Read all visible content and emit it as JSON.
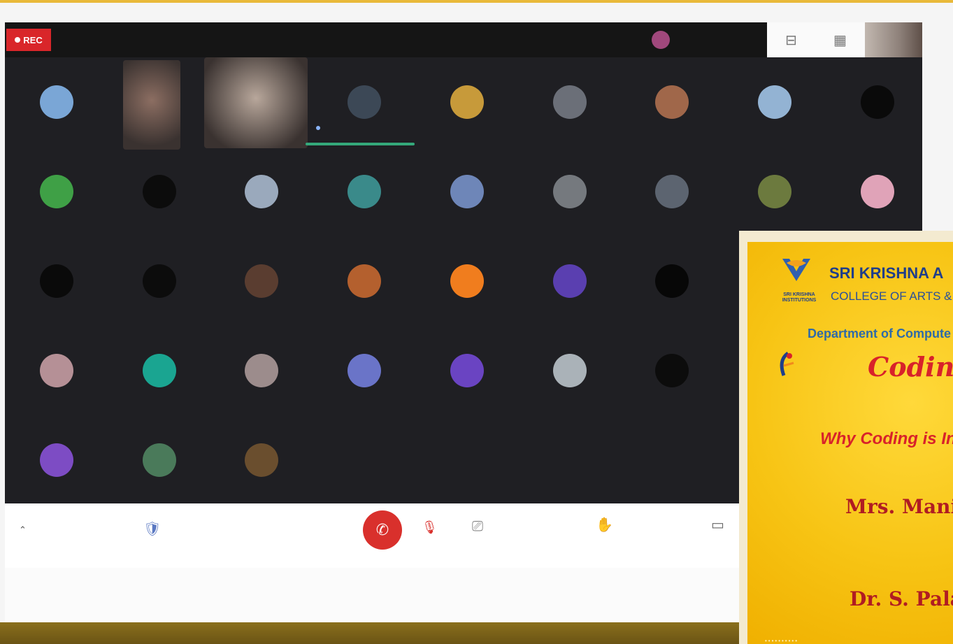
{
  "meeting": {
    "rec_label": "REC",
    "speaking_name": "",
    "speaking_sub": "",
    "speaker_name": "",
    "details_label": "",
    "url": ""
  },
  "participants": [
    {
      "type": "avatar",
      "color": "#7aa6d6",
      "initial": ""
    },
    {
      "type": "video",
      "color": "#8c6e62"
    },
    {
      "type": "video",
      "color": "#b8a79b"
    },
    {
      "type": "avatar",
      "color": "#3c4856",
      "initial": ""
    },
    {
      "type": "avatar",
      "color": "#c79a3a",
      "initial": ""
    },
    {
      "type": "avatar",
      "color": "#6b6f78",
      "initial": ""
    },
    {
      "type": "avatar",
      "color": "#a0674a",
      "initial": ""
    },
    {
      "type": "avatar",
      "color": "#93b3d3",
      "initial": ""
    },
    {
      "type": "avatar",
      "color": "#0a0a0a",
      "initial": ""
    },
    {
      "type": "avatar",
      "color": "#3fa046",
      "initial": ""
    },
    {
      "type": "avatar",
      "color": "#0c0c0c",
      "initial": ""
    },
    {
      "type": "avatar",
      "color": "#9aa9bc",
      "initial": ""
    },
    {
      "type": "avatar",
      "color": "#3a8a8a",
      "initial": ""
    },
    {
      "type": "avatar",
      "color": "#6e86b8",
      "initial": ""
    },
    {
      "type": "avatar",
      "color": "#75797e",
      "initial": ""
    },
    {
      "type": "avatar",
      "color": "#5c6470",
      "initial": ""
    },
    {
      "type": "avatar",
      "color": "#6c7a3e",
      "initial": ""
    },
    {
      "type": "avatar",
      "color": "#e0a3b8",
      "initial": ""
    },
    {
      "type": "avatar",
      "color": "#0a0a0a",
      "initial": ""
    },
    {
      "type": "avatar",
      "color": "#0c0c0c",
      "initial": ""
    },
    {
      "type": "avatar",
      "color": "#5a3d30",
      "initial": ""
    },
    {
      "type": "avatar",
      "color": "#b4602e",
      "initial": ""
    },
    {
      "type": "avatar",
      "color": "#f07d1e",
      "initial": ""
    },
    {
      "type": "avatar",
      "color": "#5a3fb0",
      "initial": ""
    },
    {
      "type": "avatar",
      "color": "#070707",
      "initial": ""
    },
    {
      "type": "avatar",
      "color": "#8fa6c4",
      "initial": ""
    },
    {
      "type": "avatar",
      "color": "#8e5ad6",
      "initial": ""
    },
    {
      "type": "avatar",
      "color": "#b59096",
      "initial": ""
    },
    {
      "type": "avatar",
      "color": "#1aa591",
      "initial": ""
    },
    {
      "type": "avatar",
      "color": "#9c8c8c",
      "initial": ""
    },
    {
      "type": "avatar",
      "color": "#6a74c8",
      "initial": ""
    },
    {
      "type": "avatar",
      "color": "#6a44c2",
      "initial": ""
    },
    {
      "type": "avatar",
      "color": "#aab2b8",
      "initial": ""
    },
    {
      "type": "avatar",
      "color": "#0c0c0c",
      "initial": ""
    },
    {
      "type": "avatar",
      "color": "#8e8672",
      "initial": ""
    },
    {
      "type": "avatar",
      "color": "#7e5a3c",
      "initial": ""
    },
    {
      "type": "avatar",
      "color": "#7d4cc4",
      "initial": ""
    },
    {
      "type": "avatar",
      "color": "#4a7a5a",
      "initial": ""
    },
    {
      "type": "avatar",
      "color": "#6a4e2e",
      "initial": ""
    }
  ],
  "poster": {
    "title": "SRI KRISHNA A",
    "college": "COLLEGE OF ARTS &",
    "logo_text": "SRI KRISHNA INSTITUTIONS",
    "location": "",
    "department": "Department of Compute",
    "iic_text": "",
    "club": "Coding Cl",
    "invite": "",
    "topic": "Why Coding is In",
    "rp_heading": "",
    "resource_person": "Mrs. Manisha",
    "rp_detail1": "",
    "rp_detail2": "",
    "pr_heading": "",
    "presider": "Dr. S. Palania",
    "pr_detail": ""
  }
}
